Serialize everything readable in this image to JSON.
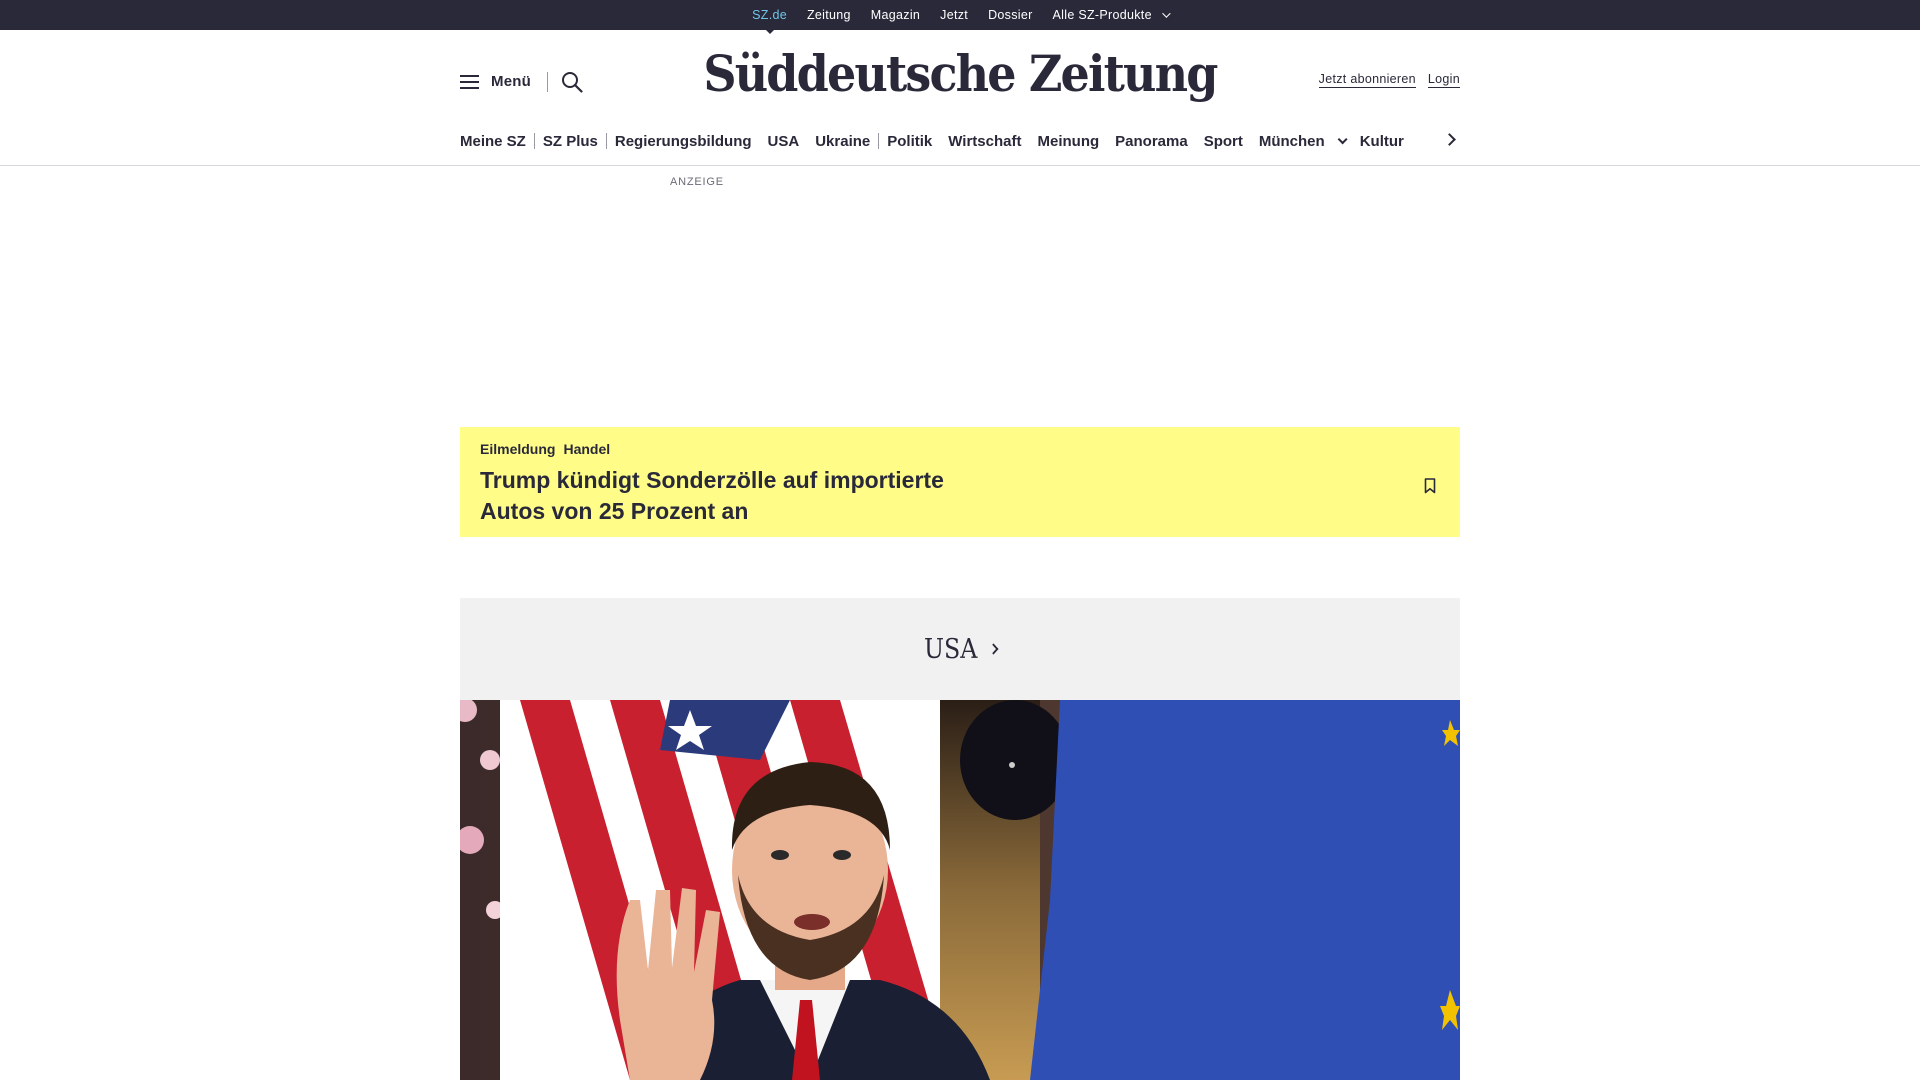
{
  "topbar": {
    "items": [
      {
        "label": "SZ.de"
      },
      {
        "label": "Zeitung"
      },
      {
        "label": "Magazin"
      },
      {
        "label": "Jetzt"
      },
      {
        "label": "Dossier"
      },
      {
        "label": "Alle SZ-Produkte"
      }
    ],
    "active_color": "#71c5e8",
    "background": "#29293a"
  },
  "header": {
    "menu_label": "Menü",
    "logo": "Süddeutsche Zeitung",
    "subscribe_label": "Jetzt abonnieren",
    "login_label": "Login"
  },
  "nav": {
    "items": [
      {
        "label": "Meine SZ"
      },
      {
        "label": "SZ Plus"
      },
      {
        "label": "Regierungsbildung"
      },
      {
        "label": "USA"
      },
      {
        "label": "Ukraine"
      },
      {
        "label": "Politik"
      },
      {
        "label": "Wirtschaft"
      },
      {
        "label": "Meinung"
      },
      {
        "label": "Panorama"
      },
      {
        "label": "Sport"
      },
      {
        "label": "München"
      },
      {
        "label": "Kultur"
      }
    ]
  },
  "ad": {
    "label": "ANZEIGE"
  },
  "breaking": {
    "tag_primary": "Eilmeldung",
    "tag_secondary": "Handel",
    "headline": "Trump kündigt Sonderzölle auf importierte Autos von 25 Prozent an",
    "background": "#fffd88"
  },
  "section": {
    "title": "USA"
  },
  "hero": {
    "icon": "article-photo"
  }
}
